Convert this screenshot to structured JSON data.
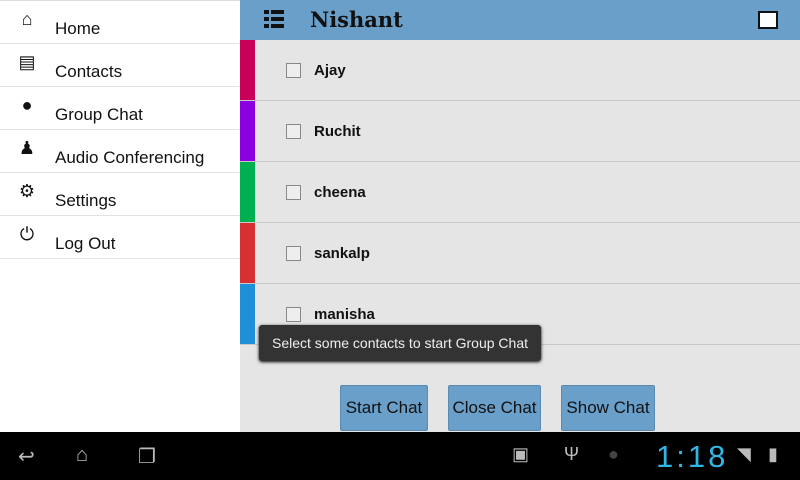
{
  "drawer": {
    "items": [
      {
        "label": "Home",
        "icon": "home-icon"
      },
      {
        "label": "Contacts",
        "icon": "contact-card-icon"
      },
      {
        "label": "Group Chat",
        "icon": "chat-bubbles-icon"
      },
      {
        "label": "Audio Conferencing",
        "icon": "people-icon"
      },
      {
        "label": "Settings",
        "icon": "gear-icon"
      },
      {
        "label": "Log Out",
        "icon": "power-icon"
      }
    ]
  },
  "header": {
    "title": "Nishant"
  },
  "contacts": [
    {
      "name": "Ajay",
      "color": "#c8005a",
      "checked": false
    },
    {
      "name": "Ruchit",
      "color": "#8a00e0",
      "checked": false
    },
    {
      "name": "cheena",
      "color": "#00b050",
      "checked": false
    },
    {
      "name": "sankalp",
      "color": "#d63030",
      "checked": false
    },
    {
      "name": "manisha",
      "color": "#1e90d8",
      "checked": false
    }
  ],
  "toast": "Select some contacts to start Group Chat",
  "buttons": {
    "start": "Start Chat",
    "close": "Close Chat",
    "show": "Show Chat"
  },
  "status": {
    "time": "1:18"
  }
}
